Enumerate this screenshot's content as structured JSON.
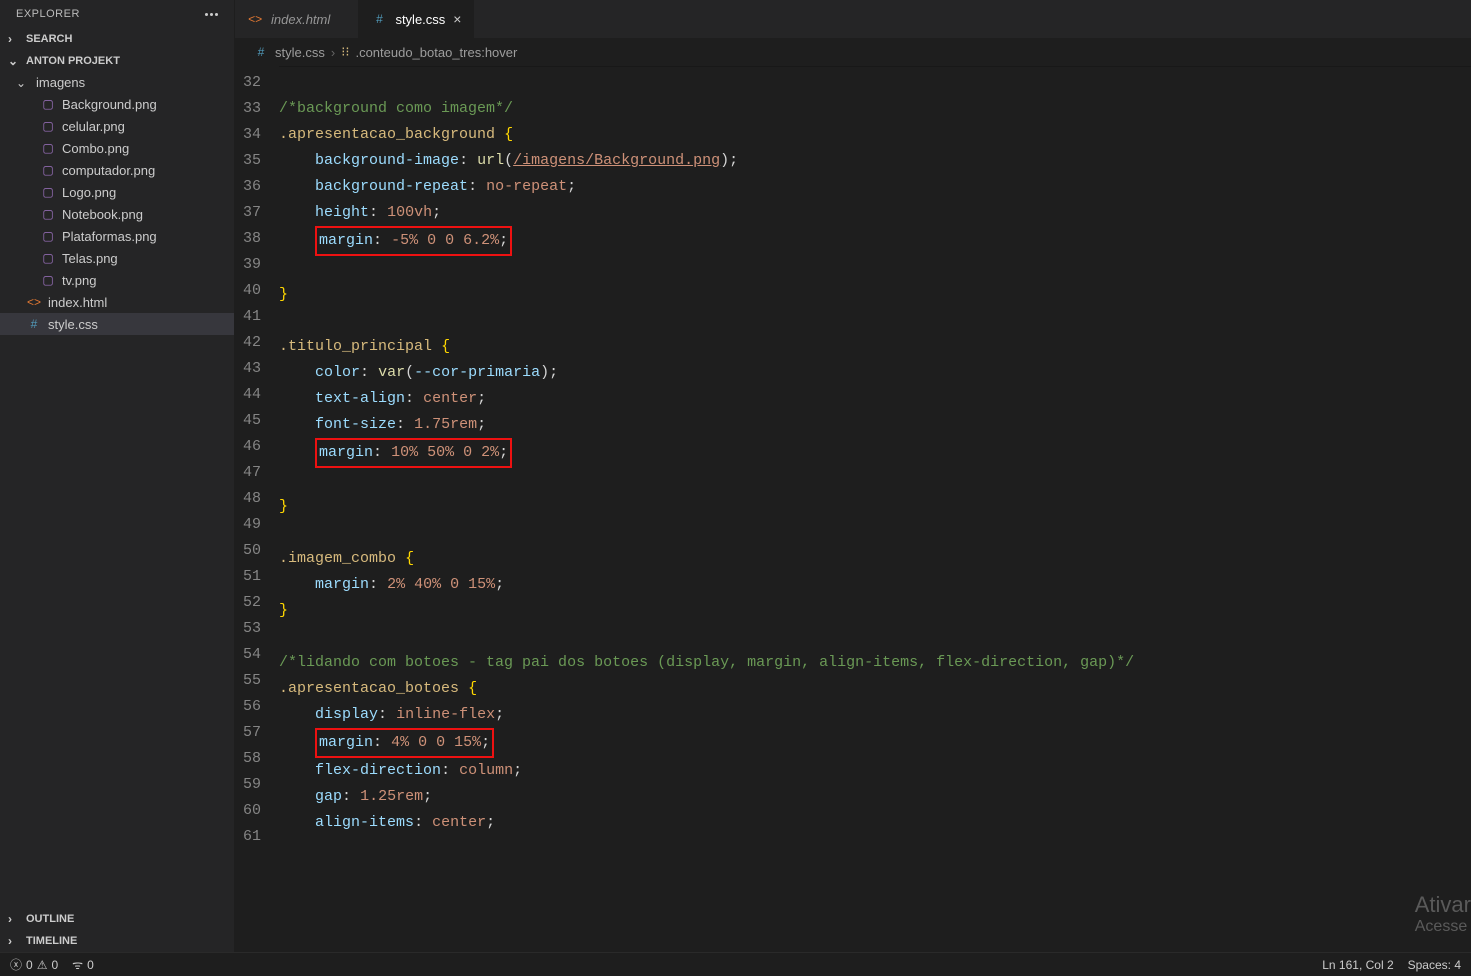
{
  "sidebar": {
    "title": "EXPLORER",
    "sections": {
      "search": "SEARCH",
      "project": "ANTON PROJEKT",
      "outline": "OUTLINE",
      "timeline": "TIMELINE"
    },
    "folder": "imagens",
    "files": [
      "Background.png",
      "celular.png",
      "Combo.png",
      "computador.png",
      "Logo.png",
      "Notebook.png",
      "Plataformas.png",
      "Telas.png",
      "tv.png"
    ],
    "rootFiles": {
      "html": "index.html",
      "css": "style.css"
    }
  },
  "tabs": {
    "0": {
      "label": "index.html"
    },
    "1": {
      "label": "style.css"
    }
  },
  "breadcrumb": {
    "file": "style.css",
    "symbol": ".conteudo_botao_tres:hover"
  },
  "code": {
    "startLine": 32,
    "lines": [
      {
        "n": 32,
        "html": ""
      },
      {
        "n": 33,
        "html": "<span class='tk-comment'>/*background como imagem*/</span>"
      },
      {
        "n": 34,
        "html": "<span class='tk-selector'>.apresentacao_background</span> <span class='tk-brace'>{</span>"
      },
      {
        "n": 35,
        "html": "    <span class='tk-prop'>background-image</span><span class='tk-punct'>:</span> <span class='tk-func'>url</span><span class='tk-punct'>(</span><span class='tk-link'>/imagens/Background.png</span><span class='tk-punct'>);</span>"
      },
      {
        "n": 36,
        "html": "    <span class='tk-prop'>background-repeat</span><span class='tk-punct'>:</span> <span class='tk-value'>no-repeat</span><span class='tk-punct'>;</span>"
      },
      {
        "n": 37,
        "html": "    <span class='tk-prop'>height</span><span class='tk-punct'>:</span> <span class='tk-value'>100vh</span><span class='tk-punct'>;</span>"
      },
      {
        "n": 38,
        "html": "    <span class='hl-box'><span class='tk-prop'>margin</span><span class='tk-punct'>:</span> <span class='tk-value'>-5% 0 0 6.2%</span><span class='tk-punct'>;</span></span>"
      },
      {
        "n": 39,
        "html": ""
      },
      {
        "n": 40,
        "html": "<span class='tk-brace'>}</span>"
      },
      {
        "n": 41,
        "html": ""
      },
      {
        "n": 42,
        "html": "<span class='tk-selector'>.titulo_principal</span> <span class='tk-brace'>{</span>"
      },
      {
        "n": 43,
        "html": "    <span class='tk-prop'>color</span><span class='tk-punct'>:</span> <span class='tk-func'>var</span><span class='tk-punct'>(</span><span class='tk-var'>--cor-primaria</span><span class='tk-punct'>);</span>"
      },
      {
        "n": 44,
        "html": "    <span class='tk-prop'>text-align</span><span class='tk-punct'>:</span> <span class='tk-value'>center</span><span class='tk-punct'>;</span>"
      },
      {
        "n": 45,
        "html": "    <span class='tk-prop'>font-size</span><span class='tk-punct'>:</span> <span class='tk-value'>1.75rem</span><span class='tk-punct'>;</span>"
      },
      {
        "n": 46,
        "html": "    <span class='hl-box'><span class='tk-prop'>margin</span><span class='tk-punct'>:</span> <span class='tk-value'>10% 50% 0 2%</span><span class='tk-punct'>;</span></span>"
      },
      {
        "n": 47,
        "html": ""
      },
      {
        "n": 48,
        "html": "<span class='tk-brace'>}</span>"
      },
      {
        "n": 49,
        "html": ""
      },
      {
        "n": 50,
        "html": "<span class='tk-selector'>.imagem_combo</span> <span class='tk-brace'>{</span>"
      },
      {
        "n": 51,
        "html": "    <span class='tk-prop'>margin</span><span class='tk-punct'>:</span> <span class='tk-value'>2% 40% 0 15%</span><span class='tk-punct'>;</span>"
      },
      {
        "n": 52,
        "html": "<span class='tk-brace'>}</span>"
      },
      {
        "n": 53,
        "html": ""
      },
      {
        "n": 54,
        "html": "<span class='tk-comment'>/*lidando com botoes - tag pai dos botoes (display, margin, align-items, flex-direction, gap)*/</span>"
      },
      {
        "n": 55,
        "html": "<span class='tk-selector'>.apresentacao_botoes</span> <span class='tk-brace'>{</span>"
      },
      {
        "n": 56,
        "html": "    <span class='tk-prop'>display</span><span class='tk-punct'>:</span> <span class='tk-value'>inline-flex</span><span class='tk-punct'>;</span>"
      },
      {
        "n": 57,
        "html": "    <span class='hl-box'><span class='tk-prop'>margin</span><span class='tk-punct'>:</span> <span class='tk-value'>4% 0 0 15%</span><span class='tk-punct'>;</span></span>"
      },
      {
        "n": 58,
        "html": "    <span class='tk-prop'>flex-direction</span><span class='tk-punct'>:</span> <span class='tk-value'>column</span><span class='tk-punct'>;</span>"
      },
      {
        "n": 59,
        "html": "    <span class='tk-prop'>gap</span><span class='tk-punct'>:</span> <span class='tk-value'>1.25rem</span><span class='tk-punct'>;</span>"
      },
      {
        "n": 60,
        "html": "    <span class='tk-prop'>align-items</span><span class='tk-punct'>:</span> <span class='tk-value'>center</span><span class='tk-punct'>;</span>"
      },
      {
        "n": 61,
        "html": ""
      }
    ]
  },
  "status": {
    "errors": "0",
    "warnings": "0",
    "port": "0",
    "cursor": "Ln 161, Col 2",
    "spaces": "Spaces: 4"
  },
  "watermark": {
    "line1": "Ativar",
    "line2": "Acesse "
  }
}
